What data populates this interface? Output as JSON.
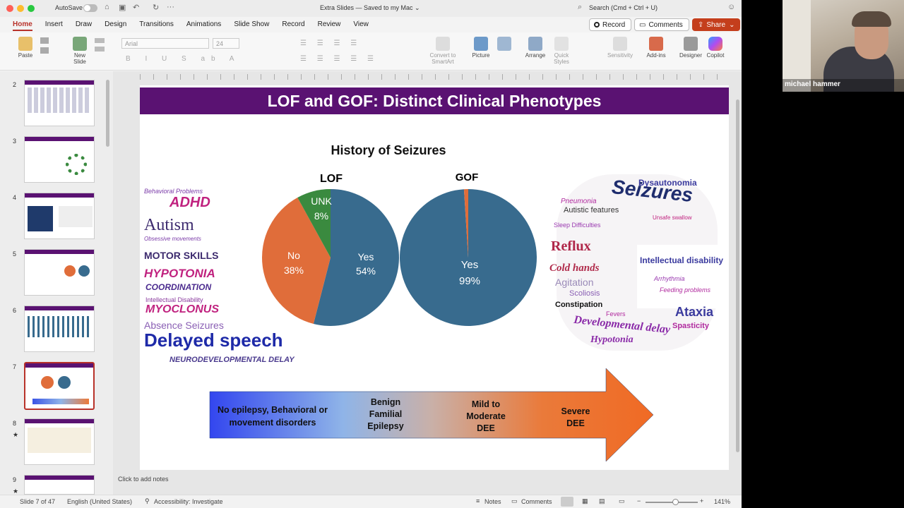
{
  "titlebar": {
    "autosave": "AutoSave",
    "doc_title": "Extra Slides — Saved to my Mac ⌄",
    "search_placeholder": "Search (Cmd + Ctrl + U)"
  },
  "menu": {
    "tabs": [
      "Home",
      "Insert",
      "Draw",
      "Design",
      "Transitions",
      "Animations",
      "Slide Show",
      "Record",
      "Review",
      "View"
    ]
  },
  "toolbar": {
    "record": "Record",
    "comments": "Comments",
    "share": "Share"
  },
  "ribbon": {
    "paste": "Paste",
    "new_slide": "New Slide",
    "font": "Arial",
    "font_size": "24",
    "convert": "Convert to SmartArt",
    "picture": "Picture",
    "arrange": "Arrange",
    "quick_styles": "Quick Styles",
    "sensitivity": "Sensitivity",
    "addins": "Add-ins",
    "designer": "Designer",
    "copilot": "Copilot"
  },
  "thumbs": {
    "numbers": [
      "2",
      "3",
      "4",
      "5",
      "6",
      "7",
      "8",
      "9"
    ]
  },
  "slide": {
    "title": "LOF and GOF: Distinct Clinical Phenotypes",
    "chart_title": "History of Seizures",
    "lof_label": "LOF",
    "gof_label": "GOF",
    "lof_yes": "Yes",
    "lof_yes_pct": "54%",
    "lof_no": "No",
    "lof_no_pct": "38%",
    "lof_unk": "UNK",
    "lof_unk_pct": "8%",
    "gof_yes": "Yes",
    "gof_yes_pct": "99%",
    "left_words": {
      "w1": "Behavioral Problems",
      "w2": "ADHD",
      "w3": "Autism",
      "w4": "Obsessive movements",
      "w5": "MOTOR SKILLS",
      "w6": "HYPOTONIA",
      "w7": "COORDINATION",
      "w8": "Intellectual Disability",
      "w9": "MYOCLONUS",
      "w10": "Absence Seizures",
      "w11": "Delayed speech",
      "w12": "NEURODEVELOPMENTAL DELAY"
    },
    "right_words": {
      "seizures": "Seizures",
      "dysautonomia": "Dysautonomia",
      "autistic": "Autistic features",
      "sleep": "Sleep Difficulties",
      "reflux": "Reflux",
      "coldhands": "Cold hands",
      "agitation": "Agitation",
      "scoliosis": "Scoliosis",
      "constipation": "Constipation",
      "devdelay": "Developmental delay",
      "hypotonia": "Hypotonia",
      "ataxia": "Ataxia",
      "spasticity": "Spasticity",
      "intellectual": "Intellectual disability",
      "unsafe": "Unsafe swallow",
      "pneumonia": "Pneumonia",
      "feeding": "Feeding problems",
      "arrhythmia": "Arrhythmia",
      "fevers": "Fevers"
    },
    "arrow": {
      "s1": "No epilepsy, Behavioral or movement disorders",
      "s2": "Benign Familial Epilepsy",
      "s3": "Mild to Moderate DEE",
      "s4": "Severe DEE"
    }
  },
  "notes": {
    "placeholder": "Click to add notes"
  },
  "status": {
    "slide": "Slide 7 of 47",
    "language": "English (United States)",
    "accessibility": "Accessibility: Investigate",
    "notes": "Notes",
    "comments": "Comments",
    "zoom": "141%"
  },
  "video": {
    "name": "michael hammer"
  },
  "chart_data": [
    {
      "type": "pie",
      "title": "LOF",
      "categories": [
        "Yes",
        "No",
        "UNK"
      ],
      "values": [
        54,
        38,
        8
      ],
      "colors": [
        "#386b8e",
        "#e06d3a",
        "#3a8a3f"
      ]
    },
    {
      "type": "pie",
      "title": "GOF",
      "categories": [
        "Yes",
        "No"
      ],
      "values": [
        99,
        1
      ],
      "colors": [
        "#386b8e",
        "#e06d3a"
      ]
    }
  ]
}
